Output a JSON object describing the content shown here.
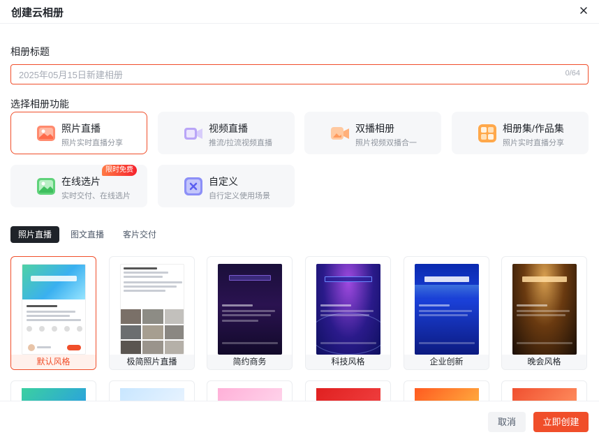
{
  "dialog": {
    "title": "创建云相册"
  },
  "album_title": {
    "label": "相册标题",
    "placeholder": "2025年05月15日新建相册",
    "value": "",
    "counter": "0/64"
  },
  "functions": {
    "label": "选择相册功能",
    "items": [
      {
        "name": "照片直播",
        "desc": "照片实时直播分享",
        "icon": "photo-live-icon",
        "color": "#ff7a5c",
        "active": true
      },
      {
        "name": "视频直播",
        "desc": "推流/拉流视频直播",
        "icon": "video-live-icon",
        "color": "#a58bf5",
        "active": false
      },
      {
        "name": "双播相册",
        "desc": "照片视频双播合一",
        "icon": "dual-live-icon",
        "color": "#ffb27a",
        "active": false
      },
      {
        "name": "相册集/作品集",
        "desc": "照片实时直播分享",
        "icon": "album-collection-icon",
        "color": "#ff9a3c",
        "active": false
      },
      {
        "name": "在线选片",
        "desc": "实时交付、在线选片",
        "icon": "online-select-icon",
        "color": "#4cc76a",
        "badge": "限时免费",
        "active": false
      },
      {
        "name": "自定义",
        "desc": "自行定义使用场景",
        "icon": "custom-icon",
        "color": "#7b7ff5",
        "active": false
      }
    ]
  },
  "tabs": [
    "照片直播",
    "图文直播",
    "客片交付"
  ],
  "templates": [
    {
      "name": "默认风格",
      "active": true
    },
    {
      "name": "极简照片直播",
      "active": false
    },
    {
      "name": "简约商务",
      "active": false
    },
    {
      "name": "科技风格",
      "active": false
    },
    {
      "name": "企业创新",
      "active": false
    },
    {
      "name": "晚会风格",
      "active": false
    }
  ],
  "colors": {
    "accent": "#f04e2a",
    "dark_tab": "#1f2329"
  },
  "footer": {
    "cancel": "取消",
    "create": "立即创建"
  }
}
